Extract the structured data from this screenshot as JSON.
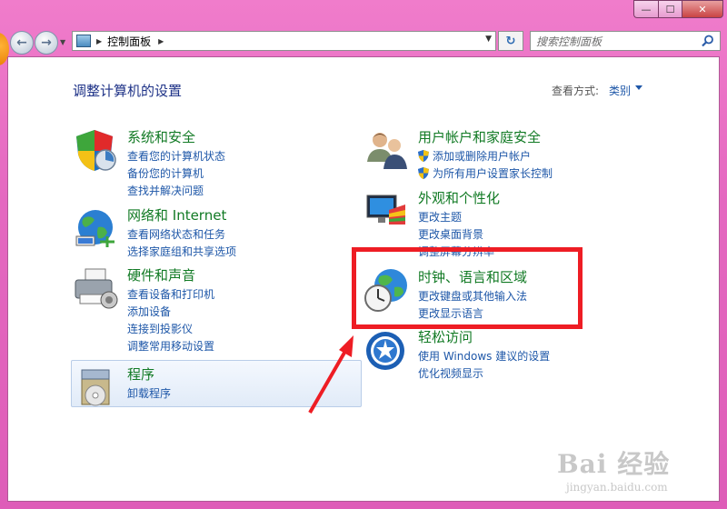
{
  "window": {
    "buttons": {
      "minimize": "—",
      "maximize": "☐",
      "close": "✕"
    }
  },
  "nav": {
    "back_icon": "arrow-left-icon",
    "forward_icon": "arrow-right-icon",
    "address_crumb": "控制面板",
    "search_placeholder": "搜索控制面板"
  },
  "header": {
    "title": "调整计算机的设置",
    "view_by_label": "查看方式:",
    "view_by_value": "类别"
  },
  "categories": {
    "system": {
      "title": "系统和安全",
      "links": [
        "查看您的计算机状态",
        "备份您的计算机",
        "查找并解决问题"
      ]
    },
    "network": {
      "title": "网络和 Internet",
      "links": [
        "查看网络状态和任务",
        "选择家庭组和共享选项"
      ]
    },
    "hardware": {
      "title": "硬件和声音",
      "links": [
        "查看设备和打印机",
        "添加设备",
        "连接到投影仪",
        "调整常用移动设置"
      ]
    },
    "programs": {
      "title": "程序",
      "links": [
        "卸载程序"
      ]
    },
    "users": {
      "title": "用户帐户和家庭安全",
      "links": [
        "添加或删除用户帐户",
        "为所有用户设置家长控制"
      ]
    },
    "appearance": {
      "title": "外观和个性化",
      "links": [
        "更改主题",
        "更改桌面背景",
        "调整屏幕分辨率"
      ]
    },
    "clock": {
      "title": "时钟、语言和区域",
      "links": [
        "更改键盘或其他输入法",
        "更改显示语言"
      ]
    },
    "ease": {
      "title": "轻松访问",
      "links": [
        "使用 Windows 建议的设置",
        "优化视频显示"
      ]
    }
  },
  "annotation": {
    "color": "#ee1d24"
  },
  "watermark": {
    "line1": "Bai 经验",
    "line2": "jingyan.baidu.com"
  },
  "colors": {
    "title_green": "#117a24",
    "link_blue": "#1e57a8",
    "frame_pink": "#e468c0"
  }
}
